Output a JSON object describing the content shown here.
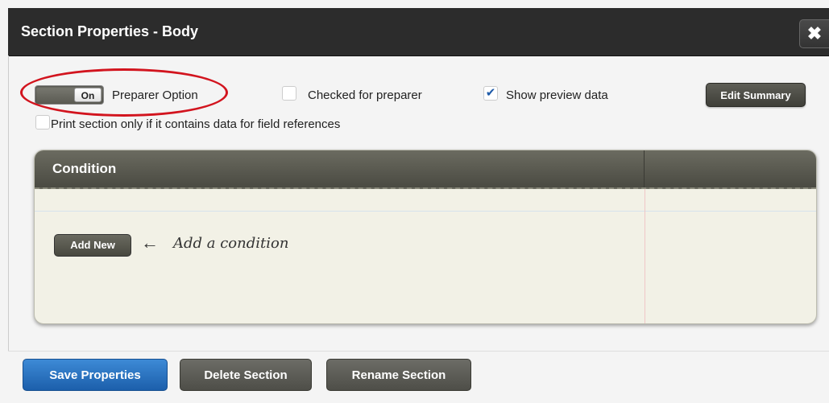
{
  "dialog": {
    "title": "Section Properties - Body",
    "close_icon": "close-icon"
  },
  "options": {
    "toggle_state": "On",
    "preparer_option_label": "Preparer Option",
    "checked_for_preparer_label": "Checked for preparer",
    "checked_for_preparer_checked": false,
    "show_preview_label": "Show preview data",
    "show_preview_checked": true,
    "edit_summary_label": "Edit Summary",
    "print_section_label": "Print section only if it contains data for field references",
    "print_section_checked": false
  },
  "condition_panel": {
    "header": "Condition",
    "add_new_label": "Add New",
    "hint_text": "Add a condition"
  },
  "footer": {
    "save_label": "Save Properties",
    "delete_label": "Delete Section",
    "rename_label": "Rename Section"
  },
  "colors": {
    "title_bar": "#2c2c2c",
    "primary_button": "#2a73c4",
    "highlight_circle": "#d2141e"
  }
}
